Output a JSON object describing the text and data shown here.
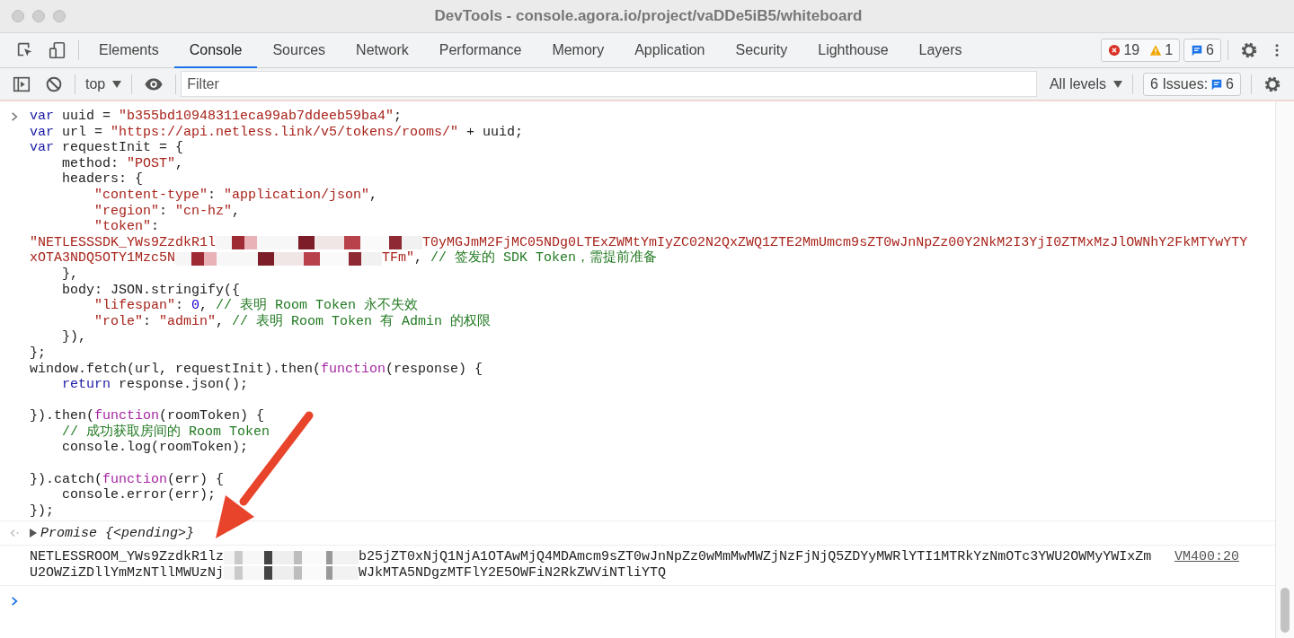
{
  "window": {
    "title": "DevTools - console.agora.io/project/vaDDe5iB5/whiteboard"
  },
  "tabs": [
    {
      "label": "Elements",
      "selected": false
    },
    {
      "label": "Console",
      "selected": true
    },
    {
      "label": "Sources",
      "selected": false
    },
    {
      "label": "Network",
      "selected": false
    },
    {
      "label": "Performance",
      "selected": false
    },
    {
      "label": "Memory",
      "selected": false
    },
    {
      "label": "Application",
      "selected": false
    },
    {
      "label": "Security",
      "selected": false
    },
    {
      "label": "Lighthouse",
      "selected": false
    },
    {
      "label": "Layers",
      "selected": false
    }
  ],
  "counters": {
    "errors": "19",
    "warnings": "1",
    "messages": "6"
  },
  "toolbar": {
    "context": "top",
    "filter_placeholder": "Filter",
    "levels": "All levels",
    "issues_label": "6 Issues:",
    "issues_count": "6"
  },
  "console": {
    "input": {
      "lines": [
        {
          "kind": "code",
          "tokens": [
            {
              "kind": "keyword",
              "text": "var"
            },
            {
              "kind": "plain",
              "text": " uuid = "
            },
            {
              "kind": "string",
              "text": "\"b355bd10948311eca99ab7ddeeb59ba4\""
            },
            {
              "kind": "plain",
              "text": ";"
            }
          ]
        },
        {
          "kind": "code",
          "tokens": [
            {
              "kind": "keyword",
              "text": "var"
            },
            {
              "kind": "plain",
              "text": " url = "
            },
            {
              "kind": "string",
              "text": "\"https://api.netless.link/v5/tokens/rooms/\""
            },
            {
              "kind": "plain",
              "text": " + uuid;"
            }
          ]
        },
        {
          "kind": "code",
          "tokens": [
            {
              "kind": "keyword",
              "text": "var"
            },
            {
              "kind": "plain",
              "text": " requestInit = {"
            }
          ]
        },
        {
          "kind": "code",
          "tokens": [
            {
              "kind": "plain",
              "text": "    method: "
            },
            {
              "kind": "string",
              "text": "\"POST\""
            },
            {
              "kind": "plain",
              "text": ","
            }
          ]
        },
        {
          "kind": "code",
          "tokens": [
            {
              "kind": "plain",
              "text": "    headers: {"
            }
          ]
        },
        {
          "kind": "code",
          "tokens": [
            {
              "kind": "string",
              "text": "        \"content-type\""
            },
            {
              "kind": "plain",
              "text": ": "
            },
            {
              "kind": "string",
              "text": "\"application/json\""
            },
            {
              "kind": "plain",
              "text": ","
            }
          ]
        },
        {
          "kind": "code",
          "tokens": [
            {
              "kind": "string",
              "text": "        \"region\""
            },
            {
              "kind": "plain",
              "text": ": "
            },
            {
              "kind": "string",
              "text": "\"cn-hz\""
            },
            {
              "kind": "plain",
              "text": ","
            }
          ]
        },
        {
          "kind": "code",
          "tokens": [
            {
              "kind": "string",
              "text": "        \"token\""
            },
            {
              "kind": "plain",
              "text": ":"
            }
          ]
        },
        {
          "kind": "code",
          "tokens": [
            {
              "kind": "string",
              "text": "\"NETLESSSDK_YWs9ZzdkR1l"
            },
            {
              "kind": "redacted"
            },
            {
              "kind": "string",
              "text": "T0yMGJmM2FjMC05NDg0LTExZWMtYmIyZC02N2QxZWQ1ZTE2MmUmcm9sZT0wJnNpZz00Y2NkM2I3YjI0ZTMxMzJlOWNhY2FkMTYwYTY"
            }
          ]
        },
        {
          "kind": "code",
          "tokens": [
            {
              "kind": "string",
              "text": "xOTA3NDQ5OTY1Mzc5N"
            },
            {
              "kind": "redacted"
            },
            {
              "kind": "string",
              "text": "TFm\""
            },
            {
              "kind": "plain",
              "text": ", "
            },
            {
              "kind": "comment",
              "text": "// 签发的 SDK Token，需提前准备"
            }
          ]
        },
        {
          "kind": "code",
          "tokens": [
            {
              "kind": "plain",
              "text": "    },"
            }
          ]
        },
        {
          "kind": "code",
          "tokens": [
            {
              "kind": "plain",
              "text": "    body: JSON.stringify({"
            }
          ]
        },
        {
          "kind": "code",
          "tokens": [
            {
              "kind": "string",
              "text": "        \"lifespan\""
            },
            {
              "kind": "plain",
              "text": ": "
            },
            {
              "kind": "number",
              "text": "0"
            },
            {
              "kind": "plain",
              "text": ", "
            },
            {
              "kind": "comment",
              "text": "// 表明 Room Token 永不失效"
            }
          ]
        },
        {
          "kind": "code",
          "tokens": [
            {
              "kind": "string",
              "text": "        \"role\""
            },
            {
              "kind": "plain",
              "text": ": "
            },
            {
              "kind": "string",
              "text": "\"admin\""
            },
            {
              "kind": "plain",
              "text": ", "
            },
            {
              "kind": "comment",
              "text": "// 表明 Room Token 有 Admin 的权限"
            }
          ]
        },
        {
          "kind": "code",
          "tokens": [
            {
              "kind": "plain",
              "text": "    }),"
            }
          ]
        },
        {
          "kind": "code",
          "tokens": [
            {
              "kind": "plain",
              "text": "};"
            }
          ]
        },
        {
          "kind": "code",
          "tokens": [
            {
              "kind": "plain",
              "text": "window.fetch(url, requestInit).then("
            },
            {
              "kind": "function",
              "text": "function"
            },
            {
              "kind": "plain",
              "text": "(response) {"
            }
          ]
        },
        {
          "kind": "code",
          "tokens": [
            {
              "kind": "keyword",
              "text": "    return"
            },
            {
              "kind": "plain",
              "text": " response.json();"
            }
          ]
        },
        {
          "kind": "blank"
        },
        {
          "kind": "code",
          "tokens": [
            {
              "kind": "plain",
              "text": "}).then("
            },
            {
              "kind": "function",
              "text": "function"
            },
            {
              "kind": "plain",
              "text": "(roomToken) {"
            }
          ]
        },
        {
          "kind": "code",
          "tokens": [
            {
              "kind": "comment",
              "text": "    // 成功获取房间的 Room Token"
            }
          ]
        },
        {
          "kind": "code",
          "tokens": [
            {
              "kind": "plain",
              "text": "    console.log(roomToken);"
            }
          ]
        },
        {
          "kind": "blank"
        },
        {
          "kind": "code",
          "tokens": [
            {
              "kind": "plain",
              "text": "}).catch("
            },
            {
              "kind": "function",
              "text": "function"
            },
            {
              "kind": "plain",
              "text": "(err) {"
            }
          ]
        },
        {
          "kind": "code",
          "tokens": [
            {
              "kind": "plain",
              "text": "    console.error(err);"
            }
          ]
        },
        {
          "kind": "code",
          "tokens": [
            {
              "kind": "plain",
              "text": "});"
            }
          ]
        }
      ]
    },
    "result": {
      "expanded": false,
      "text": "Promise {<pending>}"
    },
    "log": {
      "source": "VM400:20",
      "lines": [
        {
          "kind": "code",
          "tokens": [
            {
              "kind": "plain",
              "text": "NETLESSROOM_YWs9ZzdkR1lz"
            },
            {
              "kind": "redacted"
            },
            {
              "kind": "plain",
              "text": "b25jZT0xNjQ1NjA1OTAwMjQ4MDAmcm9sZT0wJnNpZz0wMmMwMWZjNzFjNjQ5ZDYyMWRlYTI1MTRkYzNmOTc3YWU2OWMyYWIxZm"
            }
          ]
        },
        {
          "kind": "code",
          "tokens": [
            {
              "kind": "plain",
              "text": "U2OWZiZDllYmMzNTllMWUzNj"
            },
            {
              "kind": "redacted"
            },
            {
              "kind": "plain",
              "text": "WJkMTA5NDgzMTFlY2E5OWFiN2RkZWViNTliYTQ"
            }
          ]
        }
      ]
    }
  }
}
